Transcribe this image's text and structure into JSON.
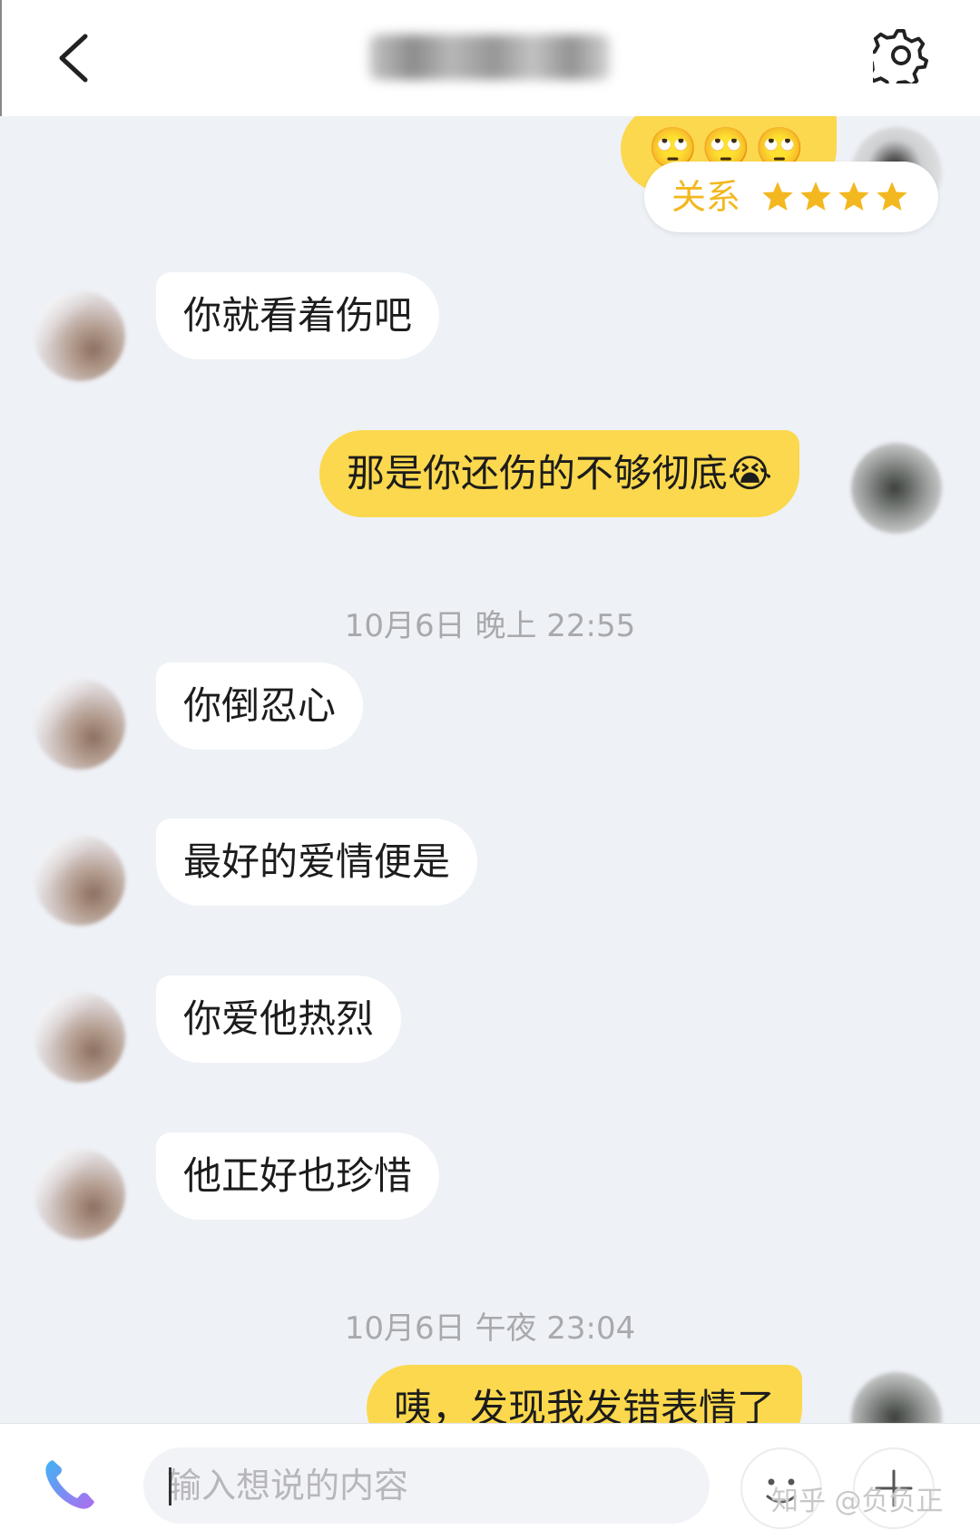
{
  "header": {
    "back_icon": "chevron-left-icon",
    "settings_icon": "gear-icon"
  },
  "messages": [
    {
      "side": "right",
      "text": "🙄🙄🙄"
    },
    {
      "side": "left",
      "text": "你就看着伤吧"
    },
    {
      "side": "right",
      "text": "那是你还伤的不够彻底😭"
    },
    {
      "side": "left",
      "text": "你倒忍心"
    },
    {
      "side": "left",
      "text": "最好的爱情便是"
    },
    {
      "side": "left",
      "text": "你爱他热烈"
    },
    {
      "side": "left",
      "text": "他正好也珍惜"
    },
    {
      "side": "right",
      "text": "咦，发现我发错表情了"
    }
  ],
  "relation_badge": {
    "label": "关系",
    "stars": 4,
    "star_color": "#f3b81f"
  },
  "timestamps": {
    "first": "10月6日 晚上 22:55",
    "second": "10月6日 午夜 23:04"
  },
  "input": {
    "placeholder": "输入想说的内容",
    "value": ""
  },
  "bottom_icons": {
    "call": "phone-icon",
    "emoji": "smiley-icon",
    "more": "plus-icon"
  },
  "watermark": "知乎 @负负正",
  "colors": {
    "accent": "#fbd84d",
    "background": "#eef1f6",
    "incoming_bubble": "#ffffff",
    "timestamp": "#a9a9ad"
  }
}
